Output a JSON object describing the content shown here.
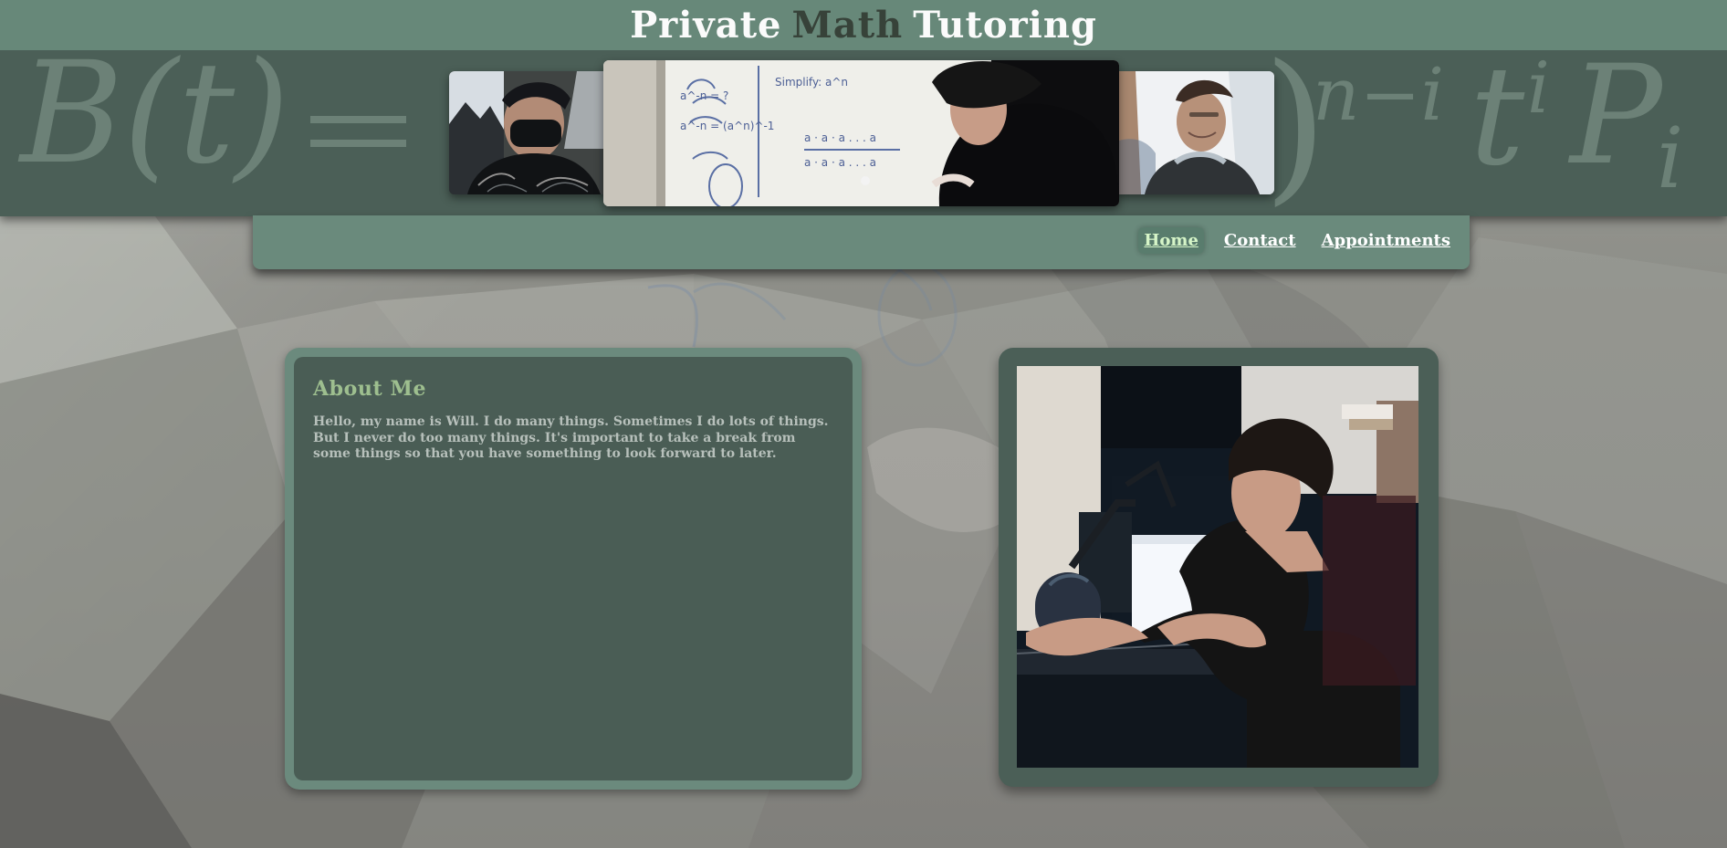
{
  "header": {
    "title_part1": "Private",
    "title_part2": "Math",
    "title_part3": "Tutoring"
  },
  "banner": {
    "formula_text": "B(t) = Σ ( n i ) (1 − t)^{n−i} t^i P_i"
  },
  "nav": {
    "items": [
      {
        "label": "Home",
        "active": true
      },
      {
        "label": "Contact",
        "active": false
      },
      {
        "label": "Appointments",
        "active": false
      }
    ]
  },
  "about": {
    "title": "About Me",
    "text": "Hello, my name is Will. I do many things. Sometimes I do lots of things. But I never do too many things. It's important to take a break from some things so that you have something to look forward to later."
  },
  "colors": {
    "title_bar": "#678879",
    "banner": "#4b5f57",
    "nav_bar": "#6a8a7c",
    "nav_active_text": "#d6f5c8",
    "about_title": "#9ebf8f",
    "about_text": "#b7c0bb",
    "card_outer": "#6b8a7d",
    "card_inner": "#4a5d55"
  },
  "icons": {
    "background_texture": "faceted-background-photo-icon",
    "banner_photo_left": "student-masked-photo-icon",
    "banner_photo_center": "whiteboard-teaching-photo-icon",
    "banner_photo_right": "portrait-photo-icon",
    "about_portrait": "keyboard-practice-photo-icon"
  }
}
